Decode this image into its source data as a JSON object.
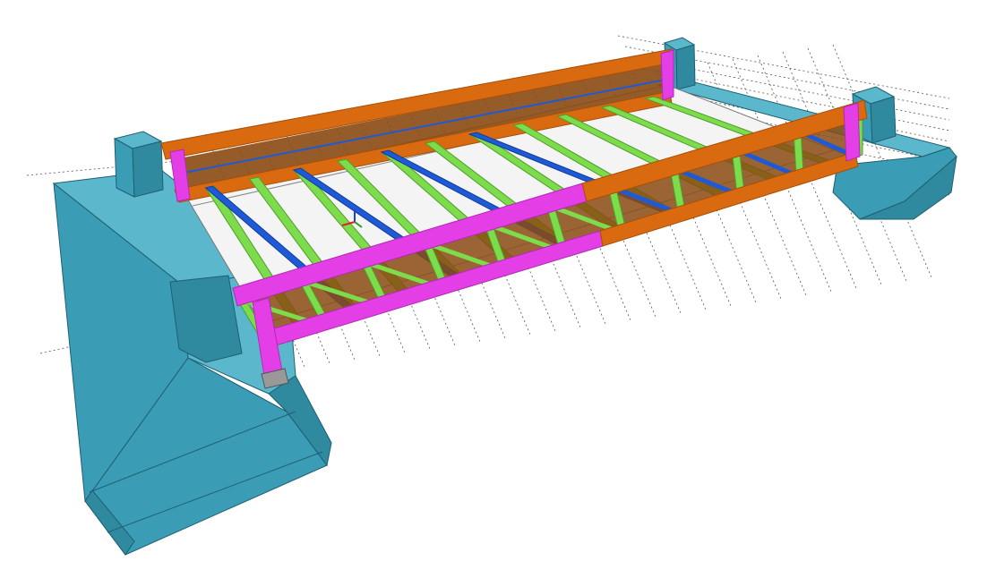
{
  "scene": {
    "kind": "3D structural model view of a steel truss bridge on two concrete abutments",
    "colors": {
      "background": "#ffffff",
      "abutment_face": "#3a9db5",
      "abutment_top": "#5bb8cc",
      "abutment_side": "#2f8aa0",
      "abutment_edge": "#1f5f70",
      "chord_orange": "#d96a10",
      "chord_orange_dark": "#a84f08",
      "post_magenta": "#e43fe6",
      "post_magenta_dark": "#b02ab3",
      "floor_beam_green": "#7ddc4b",
      "floor_beam_green_dark": "#4e9d2a",
      "bracing_blue": "#1f5ad6",
      "bracing_blue_dark": "#123c9a",
      "deck_brown": "#8a4a12",
      "gridline": "#555555",
      "axis_x": "#e02020",
      "axis_y": "#20a020",
      "axis_z": "#2040e0"
    },
    "icons": [
      "axis-triad-icon"
    ]
  }
}
